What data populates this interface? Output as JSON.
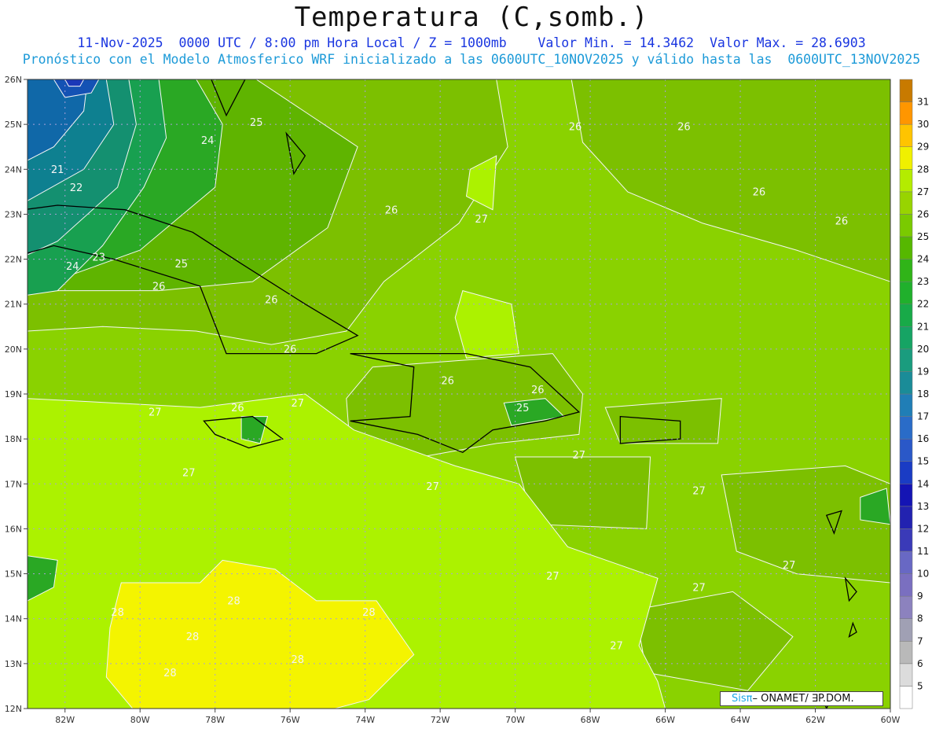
{
  "header": {
    "title": "Temperatura (C,somb.)",
    "subtitle_1": "11-Nov-2025  0000 UTC / 8:00 pm Hora Local / Z = 1000mb    Valor Min. = 14.3462  Valor Max. = 28.6903",
    "subtitle_2": "Pronóstico con el Modelo Atmosferico WRF inicializado a las 0600UTC_10NOV2025 y válido hasta las  0600UTC_13NOV2025"
  },
  "map": {
    "lat_ticks": [
      "26N",
      "25N",
      "24N",
      "23N",
      "22N",
      "21N",
      "20N",
      "19N",
      "18N",
      "17N",
      "16N",
      "15N",
      "14N",
      "13N",
      "12N"
    ],
    "lon_ticks": [
      "82W",
      "80W",
      "78W",
      "76W",
      "74W",
      "72W",
      "70W",
      "68W",
      "66W",
      "64W",
      "62W",
      "60W"
    ],
    "contour_labels": [
      {
        "text": "25",
        "lon": -76.9,
        "lat": 25.03
      },
      {
        "text": "24",
        "lon": -78.2,
        "lat": 24.63
      },
      {
        "text": "21",
        "lon": -82.2,
        "lat": 23.98
      },
      {
        "text": "22",
        "lon": -81.7,
        "lat": 23.58
      },
      {
        "text": "26",
        "lon": -73.3,
        "lat": 23.08
      },
      {
        "text": "27",
        "lon": -70.9,
        "lat": 22.88
      },
      {
        "text": "26",
        "lon": -68.4,
        "lat": 24.93
      },
      {
        "text": "26",
        "lon": -65.5,
        "lat": 24.93
      },
      {
        "text": "26",
        "lon": -63.5,
        "lat": 23.48
      },
      {
        "text": "26",
        "lon": -61.3,
        "lat": 22.83
      },
      {
        "text": "23",
        "lon": -81.1,
        "lat": 22.03
      },
      {
        "text": "24",
        "lon": -81.8,
        "lat": 21.83
      },
      {
        "text": "25",
        "lon": -78.9,
        "lat": 21.88
      },
      {
        "text": "26",
        "lon": -79.5,
        "lat": 21.38
      },
      {
        "text": "26",
        "lon": -76.5,
        "lat": 21.08
      },
      {
        "text": "26",
        "lon": -76.0,
        "lat": 19.98
      },
      {
        "text": "26",
        "lon": -71.8,
        "lat": 19.28
      },
      {
        "text": "26",
        "lon": -69.4,
        "lat": 19.08
      },
      {
        "text": "25",
        "lon": -69.8,
        "lat": 18.68
      },
      {
        "text": "27",
        "lon": -79.6,
        "lat": 18.58
      },
      {
        "text": "26",
        "lon": -77.4,
        "lat": 18.68
      },
      {
        "text": "27",
        "lon": -75.8,
        "lat": 18.78
      },
      {
        "text": "27",
        "lon": -78.7,
        "lat": 17.23
      },
      {
        "text": "27",
        "lon": -72.2,
        "lat": 16.93
      },
      {
        "text": "27",
        "lon": -68.3,
        "lat": 17.63
      },
      {
        "text": "27",
        "lon": -65.1,
        "lat": 16.83
      },
      {
        "text": "27",
        "lon": -69.0,
        "lat": 14.93
      },
      {
        "text": "27",
        "lon": -62.7,
        "lat": 15.18
      },
      {
        "text": "27",
        "lon": -65.1,
        "lat": 14.68
      },
      {
        "text": "27",
        "lon": -67.3,
        "lat": 13.38
      },
      {
        "text": "28",
        "lon": -80.6,
        "lat": 14.13
      },
      {
        "text": "28",
        "lon": -77.5,
        "lat": 14.38
      },
      {
        "text": "28",
        "lon": -78.6,
        "lat": 13.58
      },
      {
        "text": "28",
        "lon": -73.9,
        "lat": 14.13
      },
      {
        "text": "28",
        "lon": -79.2,
        "lat": 12.78
      },
      {
        "text": "28",
        "lon": -75.8,
        "lat": 13.08
      }
    ]
  },
  "colorbar": {
    "levels": [
      5,
      6,
      7,
      8,
      9,
      10,
      11,
      12,
      13,
      14,
      15,
      16,
      17,
      18,
      19,
      20,
      21,
      22,
      23,
      24,
      25,
      26,
      27,
      28,
      29,
      30,
      31
    ],
    "colors": [
      "#ffffff",
      "#dcdcdc",
      "#b9b9b9",
      "#a0a0b4",
      "#8c82be",
      "#7a6fc0",
      "#6868c4",
      "#3a3ab8",
      "#2222b0",
      "#1414b4",
      "#1a3cc4",
      "#2a58c8",
      "#2a6cc8",
      "#207eb6",
      "#1a8c98",
      "#1a9c7e",
      "#16a464",
      "#18aa48",
      "#20b02c",
      "#30b418",
      "#56b800",
      "#7aca00",
      "#98d400",
      "#b4ec00",
      "#f0f000",
      "#ffc400",
      "#ff9600",
      "#c87a00"
    ]
  },
  "colors": {
    "map_base": "#8ad200",
    "c26": "#7cc000",
    "c28": "#acf200",
    "c28hi": "#f4f400",
    "c25": "#5fb400",
    "c24": "#2aa824",
    "c23": "#18a050",
    "c22": "#149070",
    "c21": "#0e8090",
    "c20": "#1068a8",
    "c19": "#1452b4",
    "c18": "#1a38b8",
    "grid": "#a8a0d8",
    "coast": "#000000"
  },
  "credit": {
    "sis": "Sisπ",
    "rest": "– ONAMET/ ∃P.DOM."
  }
}
